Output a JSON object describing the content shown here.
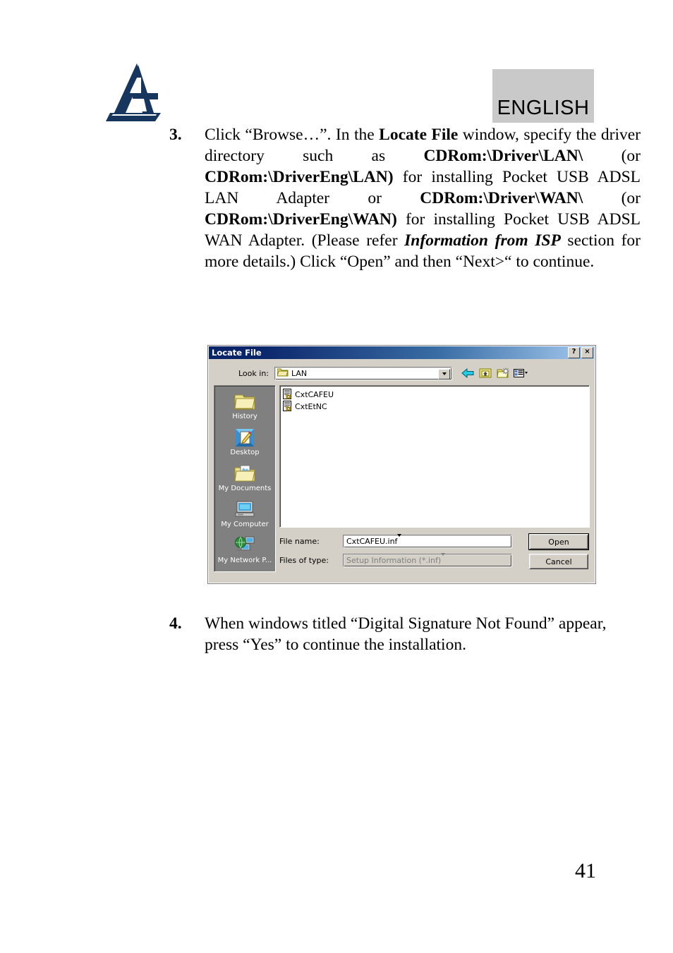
{
  "header": {
    "logo_name": "atlantis-land-logo",
    "logo_color": "#17365d",
    "language_badge": "ENGLISH",
    "badge_bg": "#c9c9c9"
  },
  "steps": [
    {
      "number": "3.",
      "segments": [
        {
          "text": "Click “Browse…”. In the ",
          "style": "normal"
        },
        {
          "text": "Locate File",
          "style": "bold"
        },
        {
          "text": " window, specify the driver directory such as ",
          "style": "normal"
        },
        {
          "text": "CDRom:\\Driver\\LAN\\",
          "style": "bold"
        },
        {
          "text": " (or ",
          "style": "normal"
        },
        {
          "text": "CDRom:\\DriverEng\\LAN)",
          "style": "bold"
        },
        {
          "text": " for installing Pocket USB ADSL LAN Adapter or ",
          "style": "normal"
        },
        {
          "text": "CDRom:\\Driver\\WAN\\",
          "style": "bold"
        },
        {
          "text": " (or ",
          "style": "normal"
        },
        {
          "text": "CDRom:\\DriverEng\\WAN)",
          "style": "bold"
        },
        {
          "text": " for installing Pocket USB ADSL WAN Adapter. (Please refer ",
          "style": "normal"
        },
        {
          "text": "Information from ISP",
          "style": "bold-italic"
        },
        {
          "text": " section for more details.) Click “Open” and then “Next>“ to continue.",
          "style": "normal"
        }
      ],
      "lines": [
        [
          {
            "t": "Click “Browse…”. In the ",
            "s": "normal"
          },
          {
            "t": "Locate File",
            "s": "bold"
          },
          {
            "t": " window,",
            "s": "normal"
          }
        ],
        [
          {
            "t": "specify the driver directory such as",
            "s": "normal"
          }
        ],
        [
          {
            "t": "CDRom:\\Driver\\LAN\\",
            "s": "bold"
          },
          {
            "t": "(or",
            "s": "normal"
          }
        ],
        [
          {
            "t": "CDRom:\\DriverEng\\LAN)",
            "s": "bold"
          },
          {
            "t": " for installing Pocket",
            "s": "normal"
          }
        ],
        [
          {
            "t": "USB ADSL LAN Adapter or",
            "s": "normal"
          }
        ],
        [
          {
            "t": "CDRom:\\Driver\\WAN\\",
            "s": "bold"
          },
          {
            "t": "(or",
            "s": "normal"
          }
        ],
        [
          {
            "t": "CDRom:\\DriverEng\\WAN)",
            "s": "bold"
          },
          {
            "t": " for installing Pocket",
            "s": "normal"
          }
        ],
        [
          {
            "t": "USB ADSL WAN Adapter. (Please refer",
            "s": "normal"
          }
        ],
        [
          {
            "t": "Information from ISP",
            "s": "bold-italic"
          },
          {
            "t": " section for more details.)",
            "s": "normal"
          }
        ],
        [
          {
            "t": "Click “Open” and then “Next>“ to continue.",
            "s": "normal"
          }
        ]
      ]
    },
    {
      "number": "4.",
      "lines": [
        [
          {
            "t": "When windows titled “Digital Signature Not Found”",
            "s": "normal"
          }
        ],
        [
          {
            "t": "appear, press “Yes” to continue the installation.",
            "s": "normal"
          }
        ]
      ]
    }
  ],
  "dialog": {
    "title": "Locate File",
    "help_button": "?",
    "close_button": "×",
    "lookin": {
      "label": "Look in:",
      "value": "LAN",
      "folder_icon": "open-folder-icon"
    },
    "toolbar": [
      {
        "name": "back-icon",
        "tip": "Back"
      },
      {
        "name": "up-one-level-icon",
        "tip": "Up One Level"
      },
      {
        "name": "new-folder-icon",
        "tip": "Create New Folder"
      },
      {
        "name": "views-icon",
        "tip": "Views"
      }
    ],
    "places": [
      {
        "label": "History",
        "icon": "history-folder-icon"
      },
      {
        "label": "Desktop",
        "icon": "desktop-icon"
      },
      {
        "label": "My Documents",
        "icon": "my-documents-icon"
      },
      {
        "label": "My Computer",
        "icon": "my-computer-icon"
      },
      {
        "label": "My Network P...",
        "icon": "my-network-places-icon"
      }
    ],
    "files": [
      {
        "name": "CxtCAFEU",
        "icon": "setup-information-icon"
      },
      {
        "name": "CxtEtNC",
        "icon": "setup-information-icon"
      }
    ],
    "filename": {
      "label": "File name:",
      "value": "CxtCAFEU.inf"
    },
    "filetype": {
      "label": "Files of type:",
      "value": "Setup Information (*.inf)",
      "disabled": true
    },
    "buttons": {
      "open": "Open",
      "cancel": "Cancel"
    },
    "titlebar_color": "#0a246a",
    "face_color": "#d4d0c8"
  },
  "footer": {
    "page_number": "41"
  }
}
